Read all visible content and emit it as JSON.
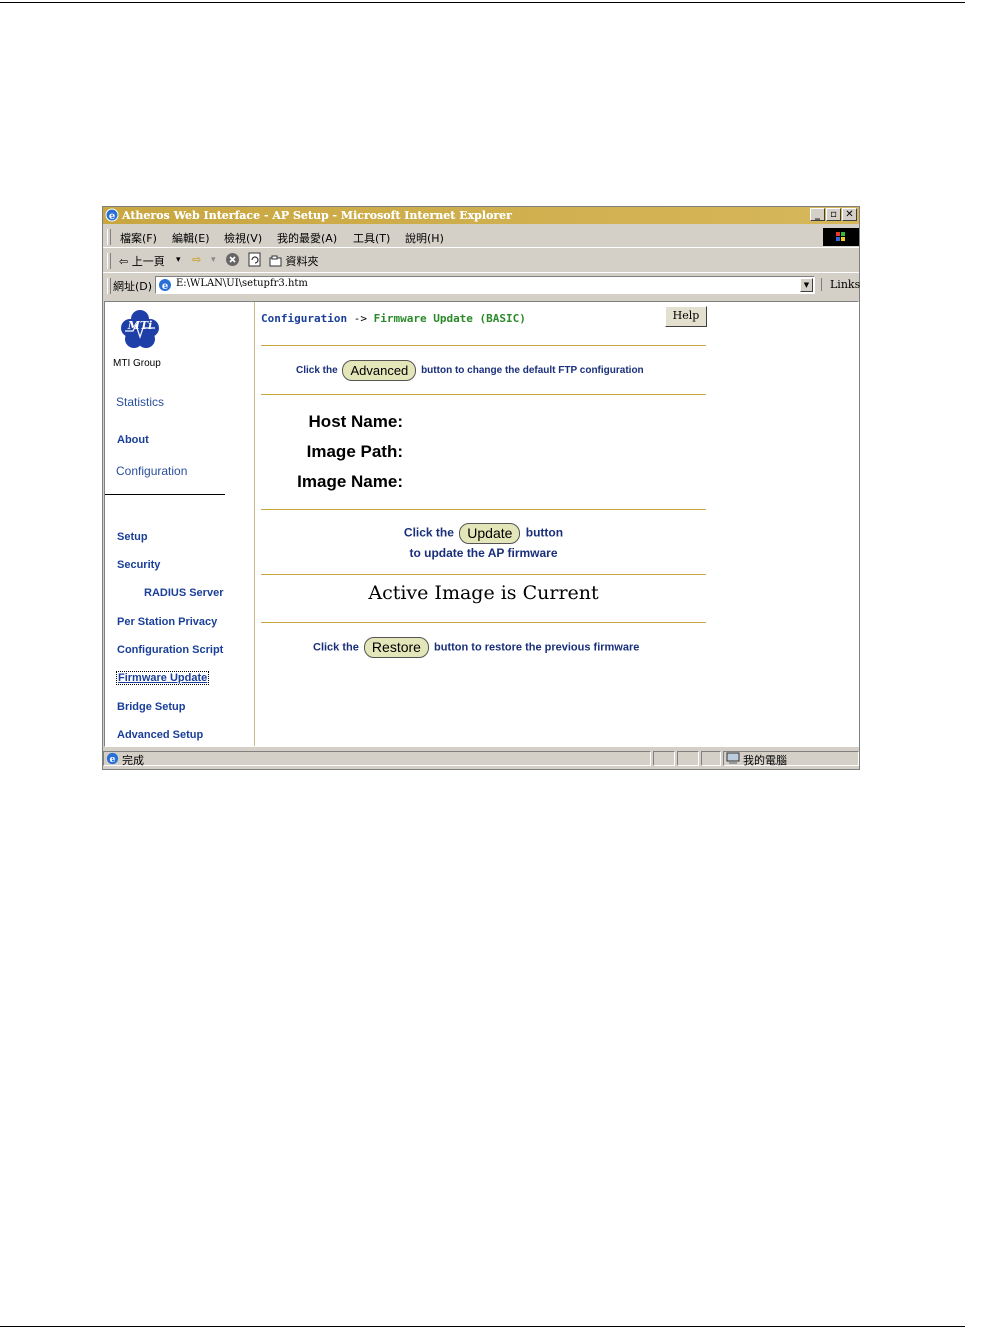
{
  "window": {
    "title": "Atheros Web Interface - AP Setup - Microsoft Internet Explorer",
    "controls": {
      "minimize": "_",
      "restore": "▫",
      "close": "✕"
    }
  },
  "menubar": {
    "items": [
      "檔案(F)",
      "編輯(E)",
      "檢視(V)",
      "我的最愛(A)",
      "工具(T)",
      "說明(H)"
    ]
  },
  "toolbar": {
    "back_label": "上一頁",
    "dropdown_glyph": "▾",
    "forward_glyph": "⇨",
    "folders_label": "資料夾"
  },
  "addressbar": {
    "label": "網址(D)",
    "value": "E:\\WLAN\\UI\\setupfr3.htm",
    "links_label": "Links"
  },
  "sidebar": {
    "logo_text": "MTi",
    "logo_caption": "MTI Group",
    "statistics": "Statistics",
    "about": "About",
    "configuration": "Configuration",
    "setup": "Setup",
    "security": "Security",
    "radius_server": "RADIUS Server",
    "per_station_privacy": "Per Station Privacy",
    "configuration_script": "Configuration Script",
    "firmware_update": "Firmware Update",
    "bridge_setup": "Bridge Setup",
    "advanced_setup": "Advanced Setup"
  },
  "main": {
    "breadcrumb_root": "Configuration",
    "breadcrumb_arrow": "->",
    "breadcrumb_current": "Firmware Update (BASIC)",
    "help_label": "Help",
    "advanced_prefix": "Click the",
    "advanced_button": "Advanced",
    "advanced_suffix": "button to change the default FTP configuration",
    "host_name_label": "Host Name:",
    "image_path_label": "Image Path:",
    "image_name_label": "Image Name:",
    "update_prefix": "Click the",
    "update_button": "Update",
    "update_suffix": "button",
    "update_line2": "to update the AP firmware",
    "active_image_status": "Active Image is Current",
    "restore_prefix": "Click the",
    "restore_button": "Restore",
    "restore_suffix": "button to restore the previous firmware"
  },
  "statusbar": {
    "status_text": "完成",
    "zone_text": "我的電腦"
  },
  "colors": {
    "titlebar": "#c8a640",
    "nav_link": "#1a3f99",
    "breadcrumb_current": "#2a8a2a",
    "button_fill": "#e3e6b8",
    "divider": "#c8a640"
  }
}
